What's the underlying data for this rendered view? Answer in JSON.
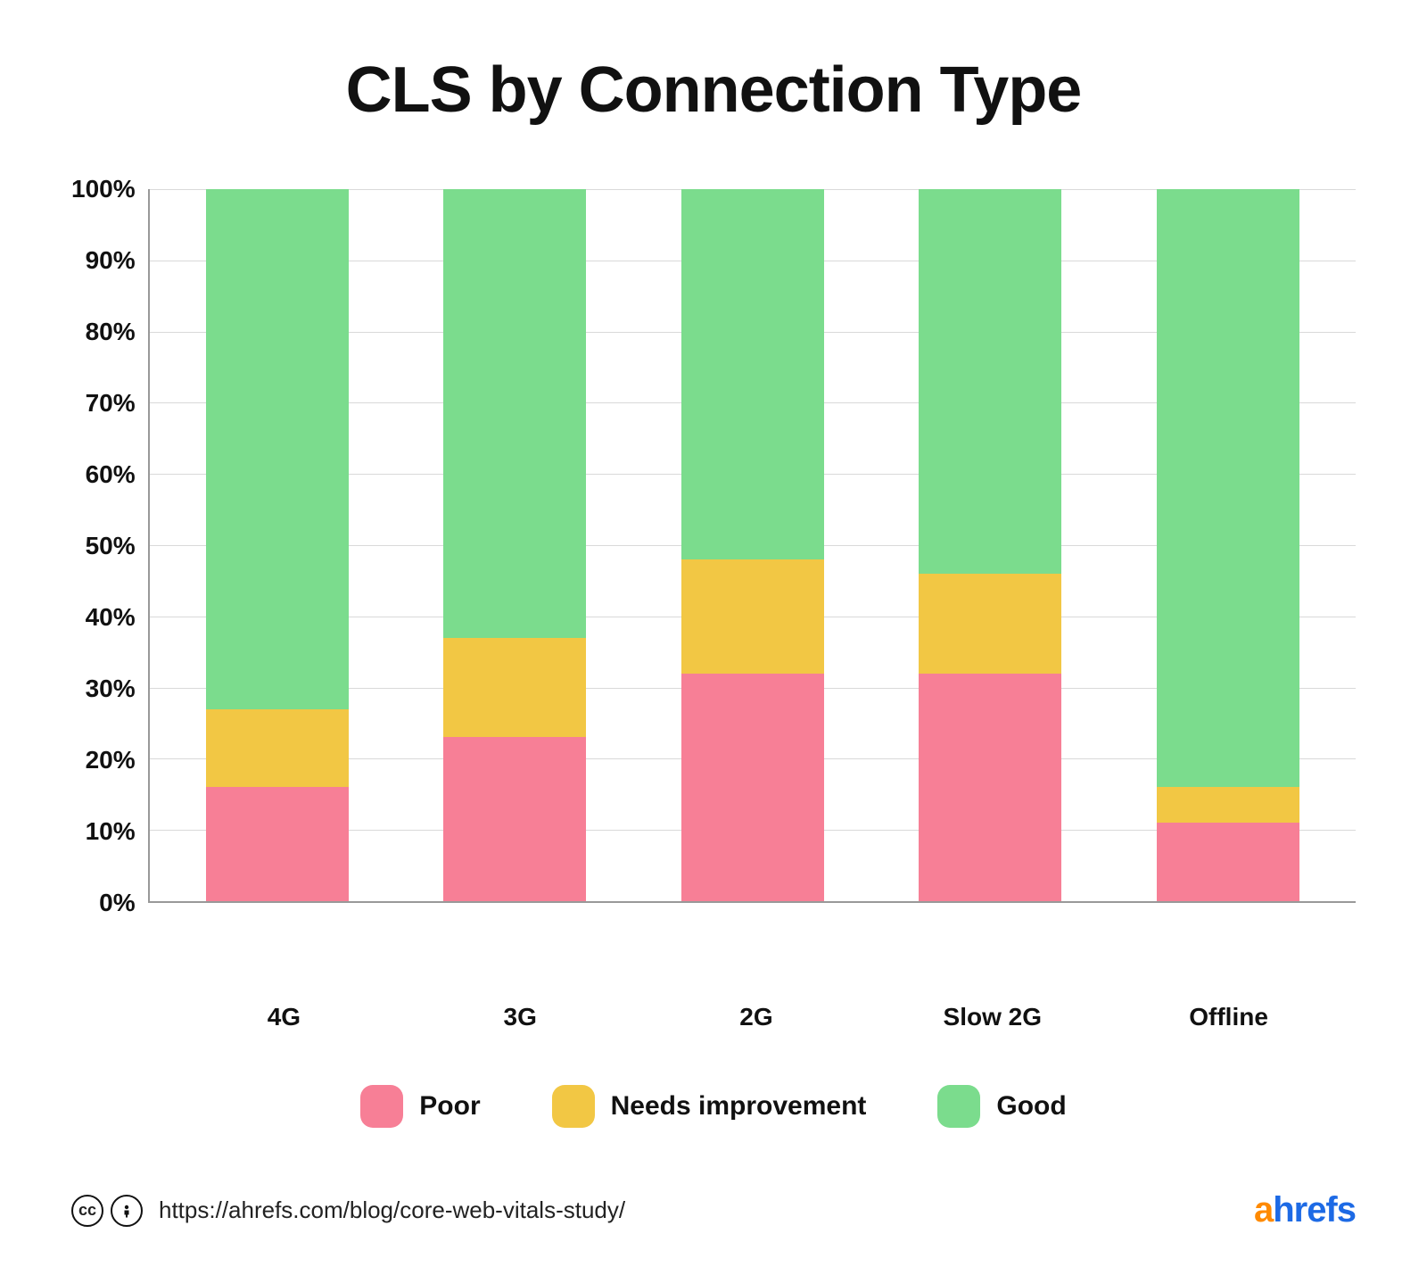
{
  "chart_data": {
    "type": "bar",
    "stacked": true,
    "title": "CLS by Connection Type",
    "xlabel": "",
    "ylabel": "",
    "ylim": [
      0,
      100
    ],
    "y_ticks": [
      "100%",
      "90%",
      "80%",
      "70%",
      "60%",
      "50%",
      "40%",
      "30%",
      "20%",
      "10%",
      "0%"
    ],
    "categories": [
      "4G",
      "3G",
      "2G",
      "Slow 2G",
      "Offline"
    ],
    "series": [
      {
        "name": "Poor",
        "color": "#f77f96",
        "values": [
          16,
          23,
          32,
          32,
          11
        ]
      },
      {
        "name": "Needs improvement",
        "color": "#f2c744",
        "values": [
          11,
          14,
          16,
          14,
          5
        ]
      },
      {
        "name": "Good",
        "color": "#7bdc8d",
        "values": [
          73,
          63,
          52,
          54,
          84
        ]
      }
    ],
    "legend_position": "bottom",
    "grid": true
  },
  "footer": {
    "source_url": "https://ahrefs.com/blog/core-web-vitals-study/",
    "brand_a": "a",
    "brand_rest": "hrefs"
  }
}
